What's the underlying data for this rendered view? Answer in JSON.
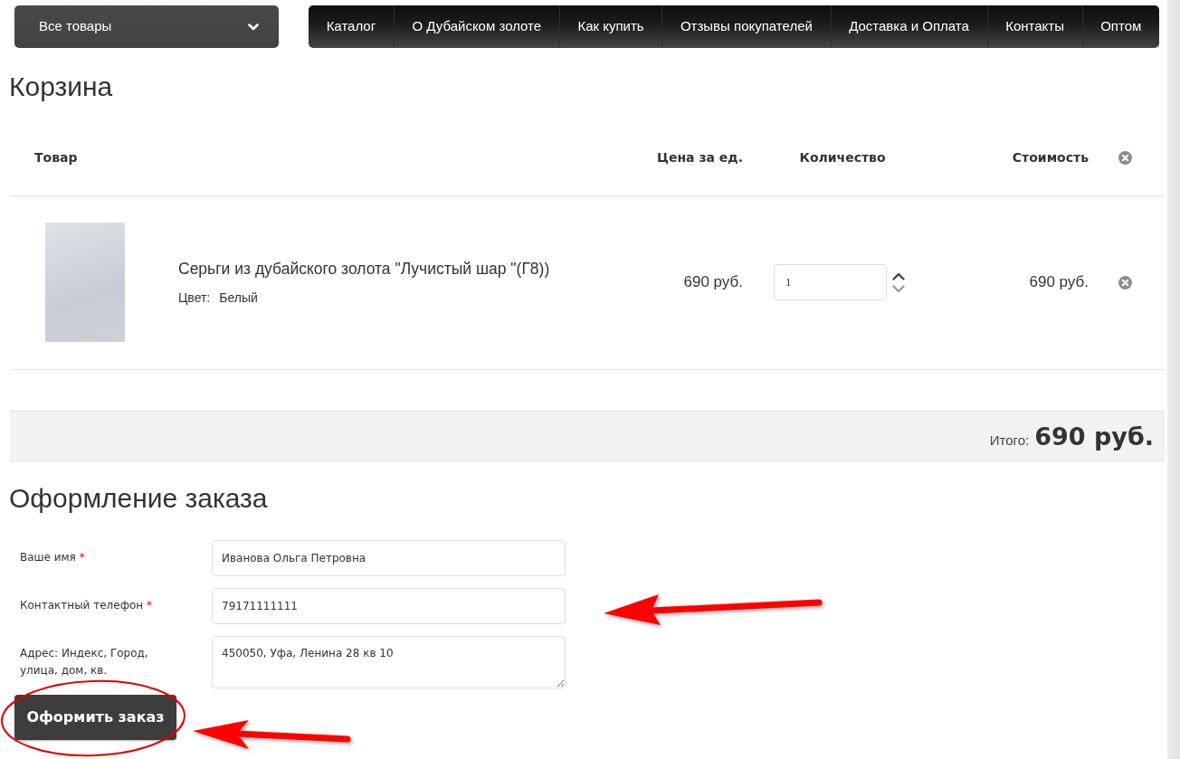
{
  "category_menu": {
    "label": "Все товары"
  },
  "nav_links": [
    "Каталог",
    "О Дубайском золоте",
    "Как купить",
    "Отзывы покупателей",
    "Доставка и Оплата",
    "Контакты",
    "Оптом"
  ],
  "page_title": "Корзина",
  "cart": {
    "columns": [
      "Товар",
      "Цена за ед.",
      "Количество",
      "Стоимость"
    ],
    "items": [
      {
        "name": "Серьги из дубайского золота \"Лучистый шар \"(Г8))",
        "option_label": "Цвет:",
        "option_value": "Белый",
        "unit_price": "690 руб.",
        "quantity": "1",
        "cost": "690 руб."
      }
    ],
    "total_label": "Итого:",
    "total": "690 руб."
  },
  "checkout": {
    "title": "Оформление заказа",
    "fields": [
      {
        "kind": "input",
        "label": "Ваше имя",
        "required_mark": "*",
        "value": "Иванова Ольга Петровна",
        "pointed_by_arrow": false
      },
      {
        "kind": "input",
        "label": "Контактный телефон",
        "required_mark": "*",
        "value": "79171111111",
        "pointed_by_arrow": true
      },
      {
        "kind": "textarea",
        "label": "Адрес: Индекс, Город, улица, дом, кв.",
        "value": "450050, Уфа, Ленина 28 кв 10",
        "pointed_by_arrow": false
      }
    ],
    "submit_button": {
      "label": "Оформить заказ",
      "circled": true,
      "pointed_by_arrow": true
    }
  }
}
